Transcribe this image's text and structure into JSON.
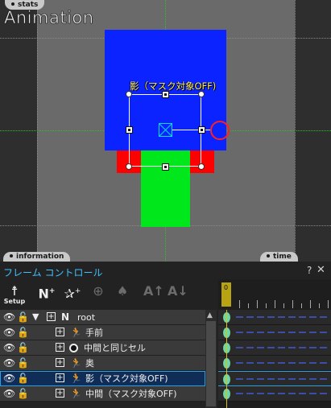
{
  "viewport": {
    "title": "Animation",
    "tag_stats": "stats",
    "tag_information": "information",
    "tag_time": "time",
    "selected_part_label": "影（マスク対象OFF)",
    "colors": {
      "stage_bg": "#6a6a6a",
      "part_blue": "#0b24ff",
      "part_red": "#ff0000",
      "part_green": "#00e81c",
      "guide_green": "#2fbf2f"
    }
  },
  "panel": {
    "title": "フレーム コントロール",
    "help": "?",
    "close": "✕",
    "toolbar": {
      "setup_label": "Setup",
      "setup_icon": "setup-figure-icon",
      "add_null_icon": "add-null-icon",
      "add_part_icon": "add-part-icon",
      "add_effect_icon": "add-effect-icon",
      "add_mask_icon": "add-mask-icon",
      "text_up_icon": "text-up-icon",
      "text_down_icon": "text-down-icon"
    },
    "tree": [
      {
        "name": "root",
        "type": "null"
      },
      {
        "name": "手前",
        "type": "part"
      },
      {
        "name": "中間と同じセル",
        "type": "mask"
      },
      {
        "name": "奥",
        "type": "part"
      },
      {
        "name": "影（マスク対象OFF)",
        "type": "part",
        "selected": true
      },
      {
        "name": "中間（マスク対象OFF)",
        "type": "part"
      }
    ],
    "timeline": {
      "current_frame": "0",
      "accent": "#b8a312",
      "key_color": "#6fd6a4"
    }
  }
}
